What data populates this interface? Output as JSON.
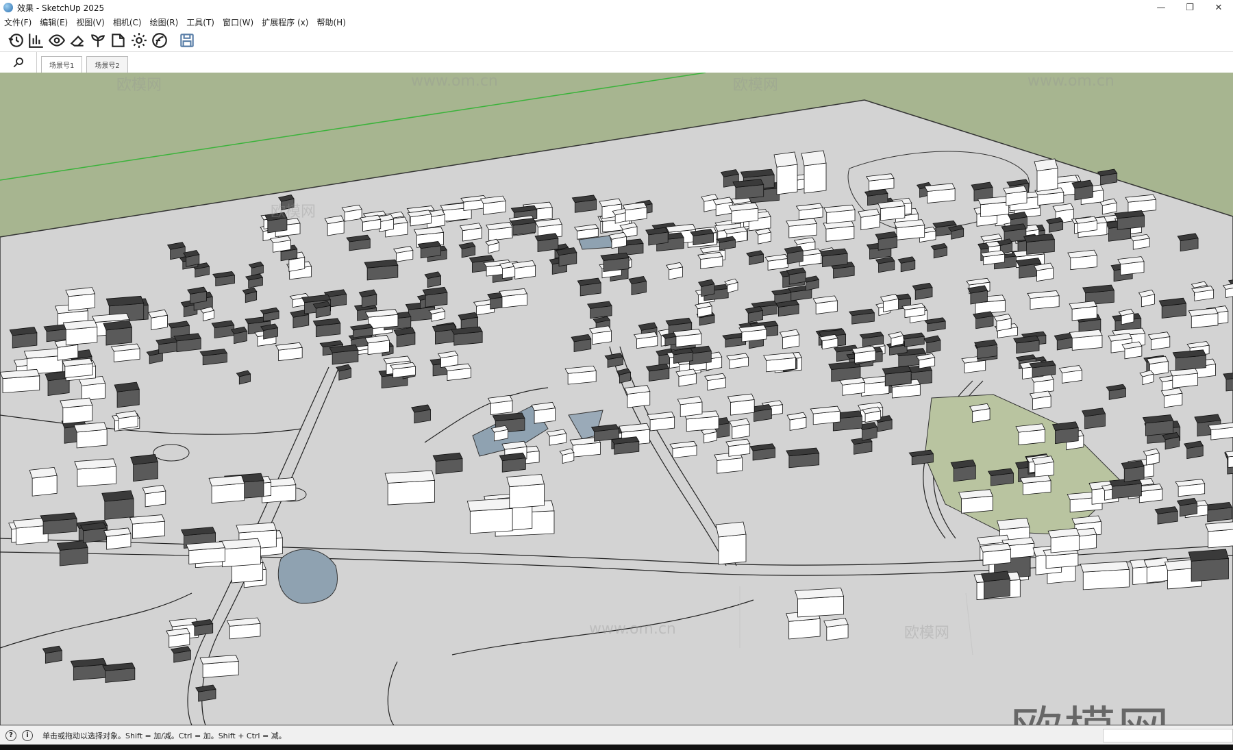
{
  "window": {
    "title": "效果 - SketchUp 2025",
    "controls": [
      "minimize-icon",
      "restore-icon",
      "close-icon"
    ]
  },
  "menu": [
    "文件(F)",
    "编辑(E)",
    "视图(V)",
    "相机(C)",
    "绘图(R)",
    "工具(T)",
    "窗口(W)",
    "扩展程序 (x)",
    "帮助(H)"
  ],
  "toolbar": {
    "icons": [
      "history-icon",
      "chart-icon",
      "eye-icon",
      "eraser-icon",
      "sprout-icon",
      "folder-icon",
      "gear-icon",
      "leaf-icon",
      "save-icon"
    ]
  },
  "scenes": {
    "tabs": [
      "场景号1",
      "场景号2"
    ],
    "active": 0
  },
  "watermarks": {
    "brand": "欧模网",
    "site": "www.om.cn"
  },
  "statusbar": {
    "text": "单击或拖动以选择对象。Shift = 加/减。Ctrl = 加。Shift + Ctrl = 减。"
  },
  "colors": {
    "sky": "#a7b590",
    "ground": "#d3d3d3",
    "roof": "#3a3a3a",
    "water": "#8fa2b1",
    "axis": "#3ab33a"
  }
}
